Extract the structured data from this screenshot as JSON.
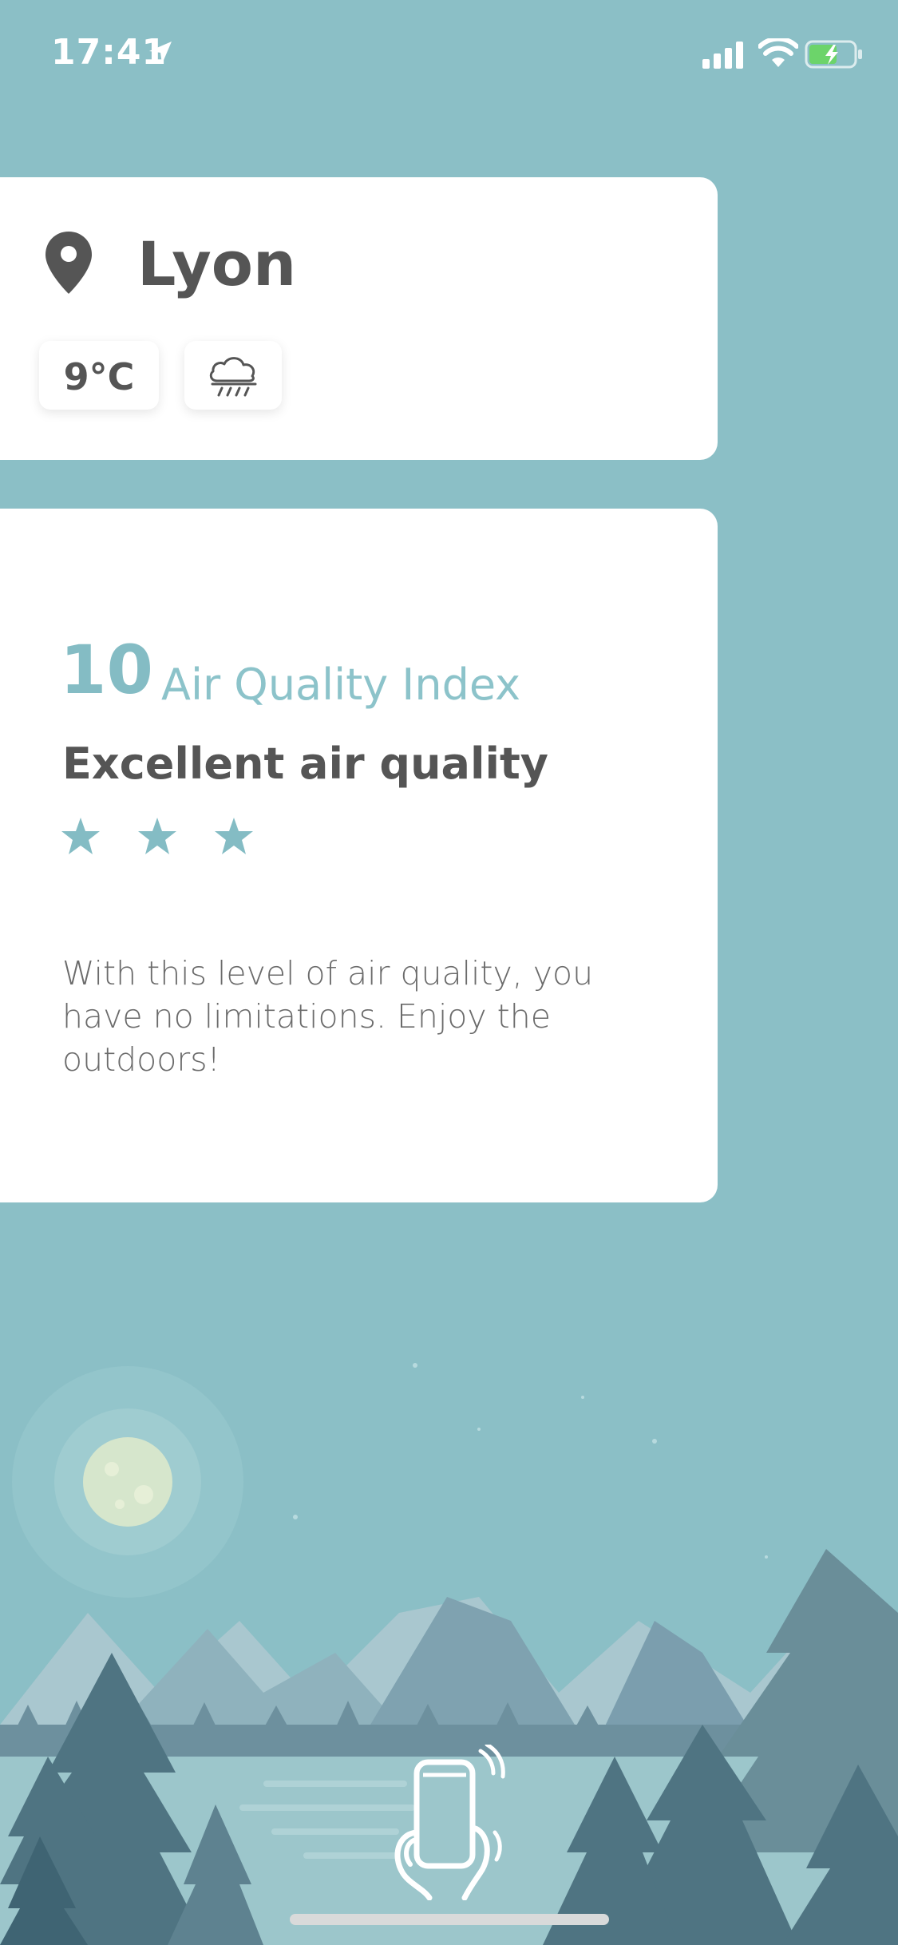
{
  "status_bar": {
    "time": "17:41",
    "icons": [
      "location-arrow-icon",
      "signal-icon",
      "wifi-icon",
      "battery-charging-icon"
    ],
    "battery_color": "#6cd46a"
  },
  "location": {
    "city": "Lyon",
    "temperature": "9°C",
    "weather_icon": "rain-cloud-icon"
  },
  "air_quality": {
    "index_value": "10",
    "index_label": "Air Quality Index",
    "status": "Excellent air quality",
    "stars": 3,
    "description": "With this level of air quality, you have no limitations. Enjoy the outdoors!"
  },
  "colors": {
    "background": "#8bbfc6",
    "accent": "#84bcc4",
    "text_dark": "#555555",
    "card": "#ffffff"
  },
  "bottom": {
    "hint_icon": "phone-shake-icon"
  }
}
